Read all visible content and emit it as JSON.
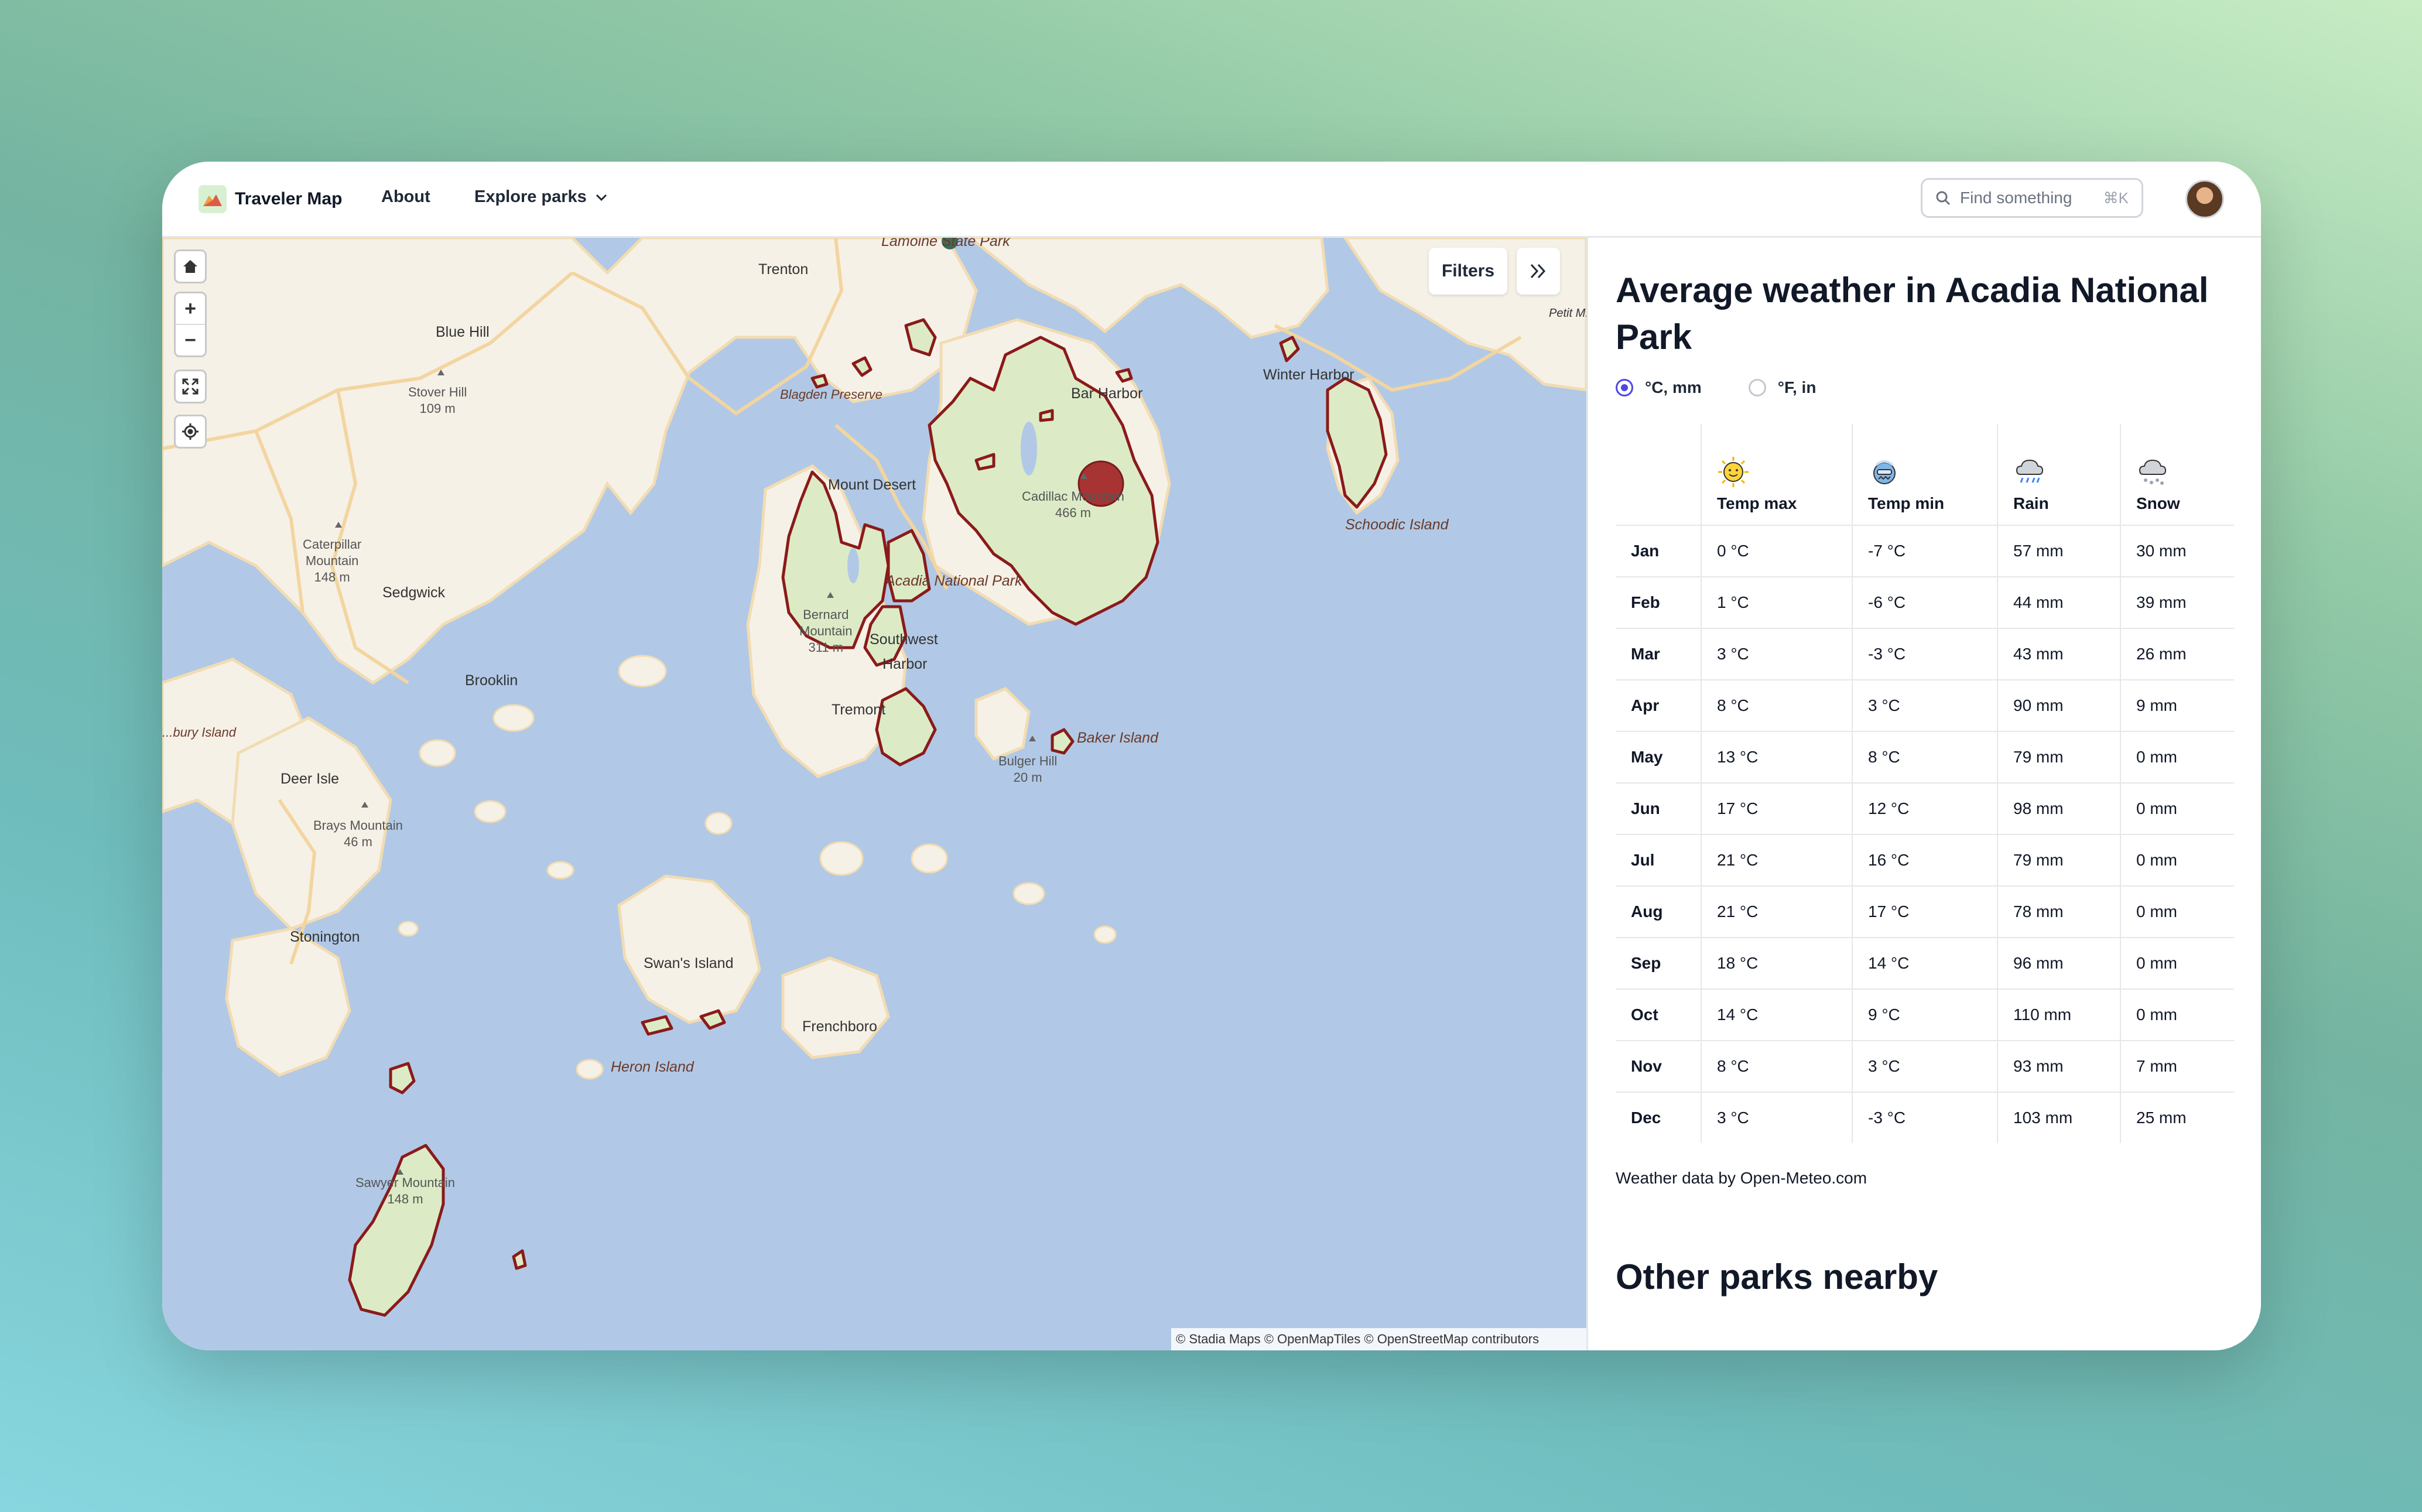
{
  "header": {
    "brand": "Traveler Map",
    "nav": {
      "about": "About",
      "explore": "Explore parks"
    },
    "search": {
      "placeholder": "Find something",
      "shortcut": "⌘K"
    }
  },
  "map": {
    "controls": {
      "home": "home-icon",
      "zoom_in": "+",
      "zoom_out": "−",
      "fullscreen": "fullscreen-icon",
      "locate": "locate-icon"
    },
    "filters_label": "Filters",
    "attribution": "© Stadia Maps © OpenMapTiles © OpenStreetMap contributors",
    "labels": {
      "lamoine": "Lamoine State Park",
      "trenton": "Trenton",
      "blue_hill": "Blue Hill",
      "stover_hill": "Stover Hill",
      "stover_hill_elev": "109 m",
      "blagden": "Blagden Preserve",
      "bar_harbor": "Bar Harbor",
      "winter_harbor": "Winter Harbor",
      "petit_manan": "Petit M...",
      "mount_desert": "Mount Desert",
      "cadillac": "Cadillac Mountain",
      "cadillac_elev": "466 m",
      "schoodic": "Schoodic Island",
      "caterpillar": "Caterpillar Mountain",
      "caterpillar_elev": "148 m",
      "sedgwick": "Sedgwick",
      "acadia": "Acadia National Park",
      "bernard": "Bernard Mountain",
      "bernard_elev": "311 m",
      "southwest_harbor": "Southwest Harbor",
      "brooklin": "Brooklin",
      "tremont": "Tremont",
      "baker": "Baker Island",
      "bury_island": "...bury Island",
      "deer_isle": "Deer Isle",
      "brays": "Brays Mountain",
      "brays_elev": "46 m",
      "bulger": "Bulger Hill",
      "bulger_elev": "20 m",
      "stonington": "Stonington",
      "swans": "Swan's Island",
      "frenchboro": "Frenchboro",
      "heron": "Heron Island",
      "sawyer": "Sawyer Mountain",
      "sawyer_elev": "148 m"
    }
  },
  "weather": {
    "title": "Average weather in Acadia National Park",
    "units": {
      "metric": "°C, mm",
      "imperial": "°F, in",
      "selected": "metric"
    },
    "columns": [
      {
        "label": "Temp max",
        "icon": "sun-icon"
      },
      {
        "label": "Temp min",
        "icon": "cold-face-icon"
      },
      {
        "label": "Rain",
        "icon": "rain-cloud-icon"
      },
      {
        "label": "Snow",
        "icon": "snow-cloud-icon"
      }
    ],
    "rows": [
      {
        "month": "Jan",
        "tmax": "0 °C",
        "tmin": "-7 °C",
        "rain": "57 mm",
        "snow": "30 mm"
      },
      {
        "month": "Feb",
        "tmax": "1 °C",
        "tmin": "-6 °C",
        "rain": "44 mm",
        "snow": "39 mm"
      },
      {
        "month": "Mar",
        "tmax": "3 °C",
        "tmin": "-3 °C",
        "rain": "43 mm",
        "snow": "26 mm"
      },
      {
        "month": "Apr",
        "tmax": "8 °C",
        "tmin": "3 °C",
        "rain": "90 mm",
        "snow": "9 mm"
      },
      {
        "month": "May",
        "tmax": "13 °C",
        "tmin": "8 °C",
        "rain": "79 mm",
        "snow": "0 mm"
      },
      {
        "month": "Jun",
        "tmax": "17 °C",
        "tmin": "12 °C",
        "rain": "98 mm",
        "snow": "0 mm"
      },
      {
        "month": "Jul",
        "tmax": "21 °C",
        "tmin": "16 °C",
        "rain": "79 mm",
        "snow": "0 mm"
      },
      {
        "month": "Aug",
        "tmax": "21 °C",
        "tmin": "17 °C",
        "rain": "78 mm",
        "snow": "0 mm"
      },
      {
        "month": "Sep",
        "tmax": "18 °C",
        "tmin": "14 °C",
        "rain": "96 mm",
        "snow": "0 mm"
      },
      {
        "month": "Oct",
        "tmax": "14 °C",
        "tmin": "9 °C",
        "rain": "110 mm",
        "snow": "0 mm"
      },
      {
        "month": "Nov",
        "tmax": "8 °C",
        "tmin": "3 °C",
        "rain": "93 mm",
        "snow": "7 mm"
      },
      {
        "month": "Dec",
        "tmax": "3 °C",
        "tmin": "-3 °C",
        "rain": "103 mm",
        "snow": "25 mm"
      }
    ],
    "source": "Weather data by Open-Meteo.com"
  },
  "nearby": {
    "title": "Other parks nearby"
  },
  "colors": {
    "water": "#b1c9e6",
    "land": "#f6f1e7",
    "park_fill": "#dcebc6",
    "park_border": "#8b1a1a",
    "accent": "#4f46e5"
  }
}
